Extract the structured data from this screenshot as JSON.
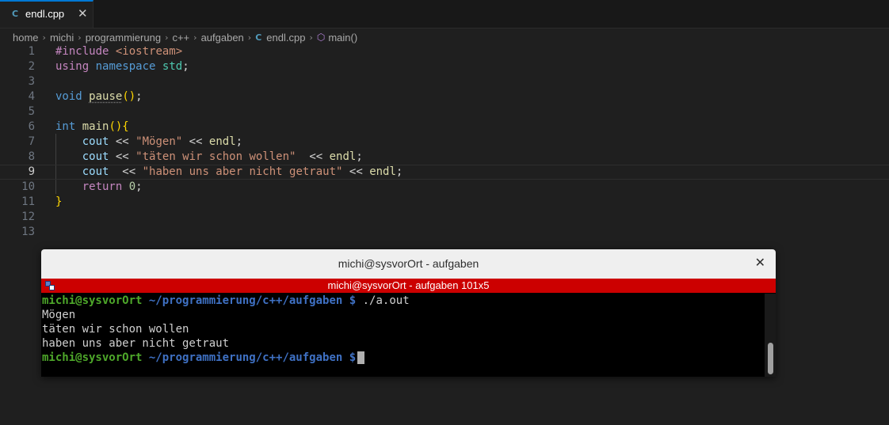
{
  "tab": {
    "icon": "C",
    "filename": "endl.cpp",
    "close": "✕"
  },
  "breadcrumb": [
    "home",
    "michi",
    "programmierung",
    "c++",
    "aufgaben",
    "endl.cpp",
    "main()"
  ],
  "editor": {
    "line_numbers": [
      "1",
      "2",
      "3",
      "4",
      "5",
      "6",
      "7",
      "8",
      "9",
      "10",
      "11",
      "12",
      "13"
    ],
    "active_line": "9",
    "lines": [
      "#include <iostream>",
      "using namespace std;",
      "",
      "void pause();",
      "",
      "int main(){",
      "    cout << \"Mögen\" << endl;",
      "    cout << \"täten wir schon wollen\"  << endl;",
      "    cout  << \"haben uns aber nicht getraut\" << endl;",
      "    return 0;",
      "}",
      "",
      ""
    ]
  },
  "terminal": {
    "window_title": "michi@sysvorOrt - aufgaben",
    "close": "✕",
    "tab_title": "michi@sysvorOrt - aufgaben 101x5",
    "prompt_user": "michi@sysvorOrt",
    "prompt_path": "~/programmierung/c++/aufgaben",
    "prompt_symbol": "$",
    "command": "./a.out",
    "output": [
      "Mögen",
      "täten wir schon wollen",
      "haben uns aber nicht getraut"
    ]
  },
  "colors": {
    "accent": "#0078d4",
    "terminal_tab": "#cc0000",
    "prompt_user": "#4ea82a",
    "prompt_path": "#3f71c4"
  }
}
